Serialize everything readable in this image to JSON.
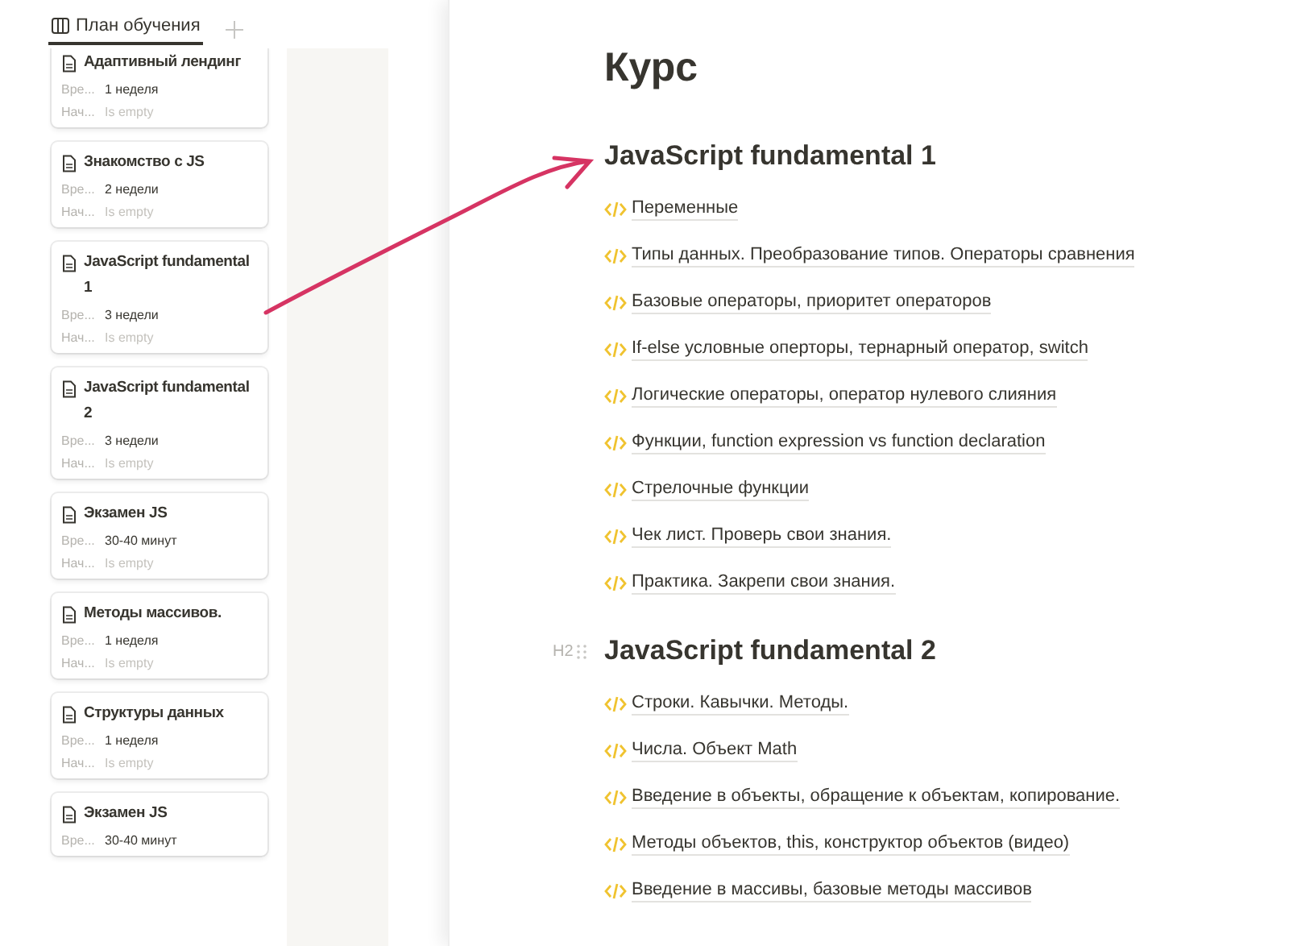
{
  "view_tab": {
    "label": "План обучения",
    "selected": true
  },
  "cards": [
    {
      "title": "Адаптивный лендинг",
      "fields": [
        {
          "label": "Вре...",
          "value": "1 неделя"
        },
        {
          "label": "Нач...",
          "placeholder": "Is empty"
        }
      ]
    },
    {
      "title": "Знакомство с JS",
      "fields": [
        {
          "label": "Вре...",
          "value": "2 недели"
        },
        {
          "label": "Нач...",
          "placeholder": "Is empty"
        }
      ]
    },
    {
      "title": "JavaScript fundamental 1",
      "fields": [
        {
          "label": "Вре...",
          "value": "3 недели"
        },
        {
          "label": "Нач...",
          "placeholder": "Is empty"
        }
      ]
    },
    {
      "title": "JavaScript fundamental 2",
      "fields": [
        {
          "label": "Вре...",
          "value": "3 недели"
        },
        {
          "label": "Нач...",
          "placeholder": "Is empty"
        }
      ]
    },
    {
      "title": "Экзамен JS",
      "fields": [
        {
          "label": "Вре...",
          "value": "30-40 минут"
        },
        {
          "label": "Нач...",
          "placeholder": "Is empty"
        }
      ]
    },
    {
      "title": "Методы массивов.",
      "fields": [
        {
          "label": "Вре...",
          "value": "1 неделя"
        },
        {
          "label": "Нач...",
          "placeholder": "Is empty"
        }
      ]
    },
    {
      "title": "Структуры данных",
      "fields": [
        {
          "label": "Вре...",
          "value": "1 неделя"
        },
        {
          "label": "Нач...",
          "placeholder": "Is empty"
        }
      ]
    },
    {
      "title": "Экзамен JS",
      "fields": [
        {
          "label": "Вре...",
          "value": "30-40 минут"
        }
      ]
    }
  ],
  "page": {
    "title": "Курс",
    "sections": [
      {
        "heading": "JavaScript fundamental 1",
        "items": [
          "Переменные",
          "Типы данных. Преобразование типов. Операторы сравнения",
          "Базовые операторы, приоритет операторов",
          "If-else условные оперторы, тернарный оператор, switch",
          "Логические операторы, оператор нулевого слияния",
          "Функции, function expression vs function declaration",
          "Стрелочные функции",
          "Чек лист. Проверь свои знания.",
          "Практика. Закрепи свои знания."
        ]
      },
      {
        "heading": "JavaScript fundamental 2",
        "hover_label": "H2",
        "items": [
          "Строки. Кавычки. Методы.",
          "Числа. Объект Math",
          "Введение в объекты, обращение к объектам, копирование.",
          "Методы объектов, this, конструктор объектов (видео)",
          "Введение в массивы, базовые методы массивов"
        ]
      }
    ]
  }
}
